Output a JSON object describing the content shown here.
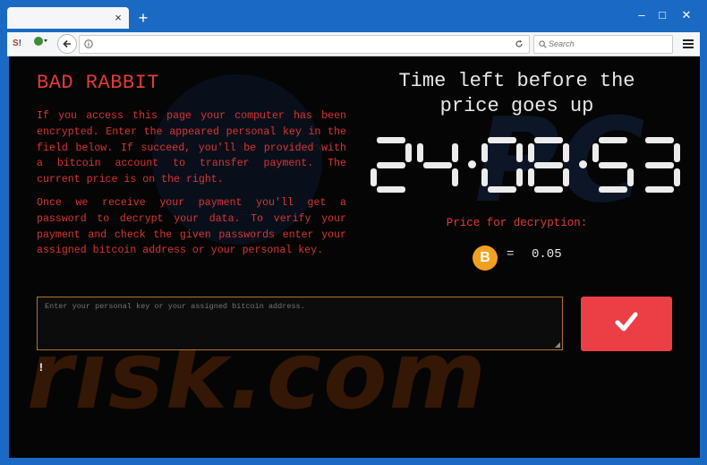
{
  "browser": {
    "tab_close": "×",
    "new_tab": "+",
    "window_controls": {
      "minimize": "–",
      "maximize": "□",
      "close": "✕"
    },
    "search_placeholder": "Search",
    "url_value": ""
  },
  "icons": {
    "site": "site-logo-icon",
    "addon": "shield-addon-icon",
    "back": "back-arrow-icon",
    "info": "info-icon",
    "reload": "reload-icon",
    "search": "search-icon",
    "menu": "hamburger-menu-icon",
    "bitcoin": "bitcoin-icon",
    "check": "checkmark-icon"
  },
  "ransom": {
    "title": "BAD RABBIT",
    "paragraph1": "If you access this page your computer has been encrypted. Enter the appeared personal key in the field below. If succeed, you'll be provided with a bitcoin account to transfer payment. The current price is on the right.",
    "paragraph2": "Once we receive your payment you'll get a password to decrypt your data. To verify your payment and check the given passwords enter your assigned bitcoin address or your personal key.",
    "timer_caption": "Time left before the price goes up",
    "timer": "24:08:53",
    "price_label": "Price for decryption:",
    "bitcoin_symbol": "B",
    "equals": "=",
    "price_value": "0.05",
    "key_placeholder": "Enter your personal key or your assigned bitcoin address.",
    "error_mark": "!"
  },
  "colors": {
    "accent_red": "#e23b3b",
    "button_red": "#ec3f45",
    "bitcoin_orange": "#f2a021",
    "background": "#050505"
  }
}
